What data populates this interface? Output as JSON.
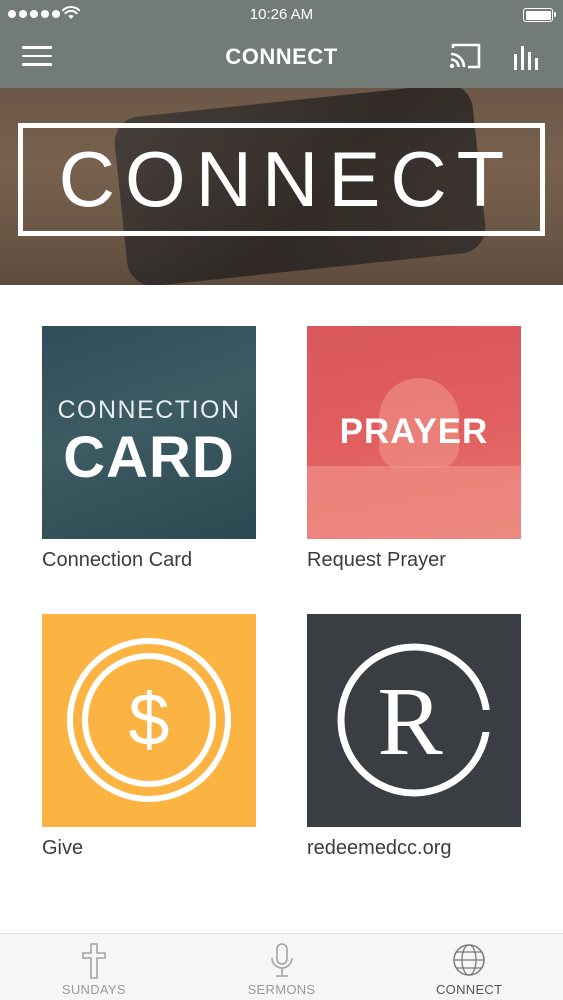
{
  "status_bar": {
    "time": "10:26 AM",
    "signal_bars": 5,
    "battery_level": 1.0
  },
  "nav": {
    "title": "CONNECT",
    "menu_icon": "hamburger-icon",
    "cast_icon": "cast-icon",
    "stats_icon": "bar-chart-icon"
  },
  "banner": {
    "text": "CONNECT"
  },
  "tiles": [
    {
      "caption": "Connection Card",
      "image_line1": "CONNECTION",
      "image_line2": "CARD"
    },
    {
      "caption": "Request Prayer",
      "image_word": "PRAYER"
    },
    {
      "caption": "Give",
      "image_symbol": "$"
    },
    {
      "caption": "redeemedcc.org",
      "image_letter": "R"
    }
  ],
  "tabbar": {
    "tabs": [
      {
        "label": "SUNDAYS",
        "icon": "cross-icon"
      },
      {
        "label": "SERMONS",
        "icon": "microphone-icon"
      },
      {
        "label": "CONNECT",
        "icon": "globe-icon",
        "active": true
      }
    ]
  },
  "colors": {
    "nav_bg": "#737b77",
    "card_bg": "#3d5b63",
    "prayer_bg": "#e25e60",
    "give_bg": "#fbb442",
    "web_bg": "#3a3d41"
  }
}
